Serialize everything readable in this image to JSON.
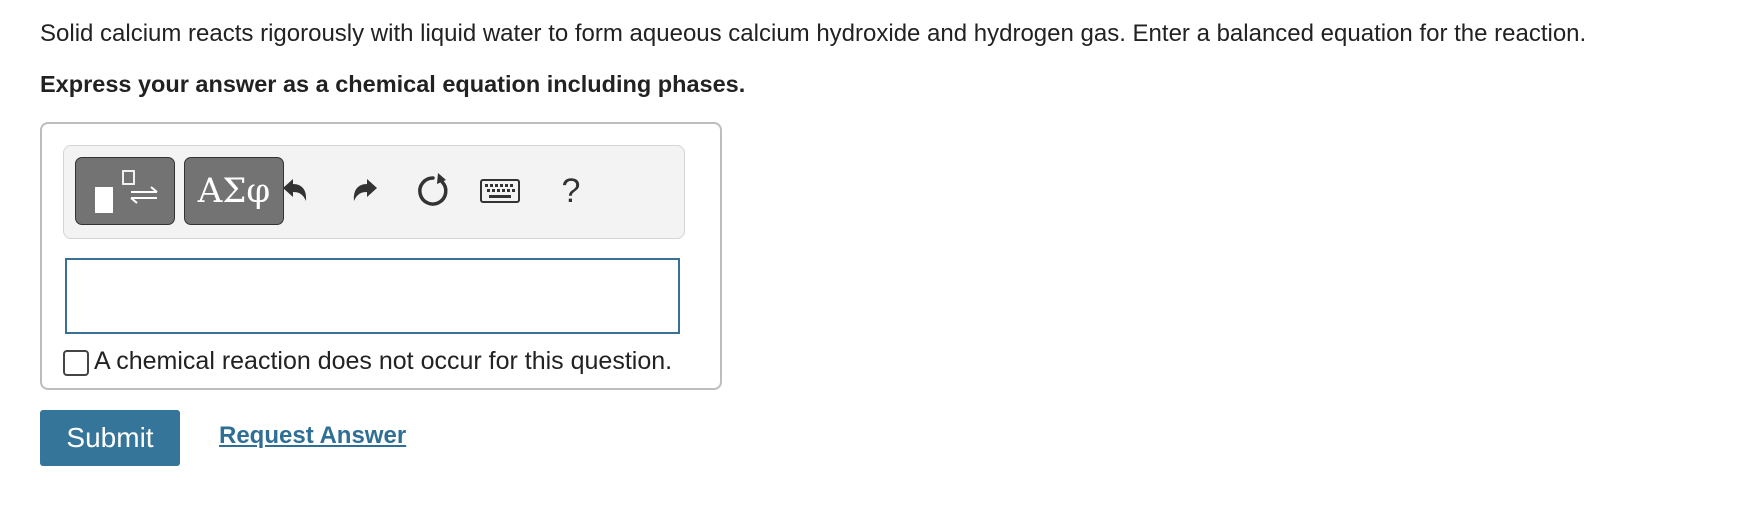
{
  "question": {
    "text": "Solid calcium reacts rigorously with liquid water to form aqueous calcium hydroxide and hydrogen gas. Enter a balanced equation for the reaction.",
    "instruction": "Express your answer as a chemical equation including phases."
  },
  "toolbar": {
    "templates_icon": "template-arrows-icon",
    "symbols_label": "ΑΣφ",
    "undo_icon": "undo-icon",
    "redo_icon": "redo-icon",
    "reset_icon": "reset-icon",
    "keyboard_icon": "keyboard-icon",
    "help_label": "?"
  },
  "answer": {
    "value": "",
    "placeholder": ""
  },
  "no_reaction_checkbox": {
    "checked": false,
    "label": "A chemical reaction does not occur for this question."
  },
  "actions": {
    "submit_label": "Submit",
    "request_answer_label": "Request Answer"
  },
  "colors": {
    "primary": "#357599",
    "link": "#2f6f96",
    "tool_button": "#737373",
    "input_border": "#3a6f96"
  }
}
